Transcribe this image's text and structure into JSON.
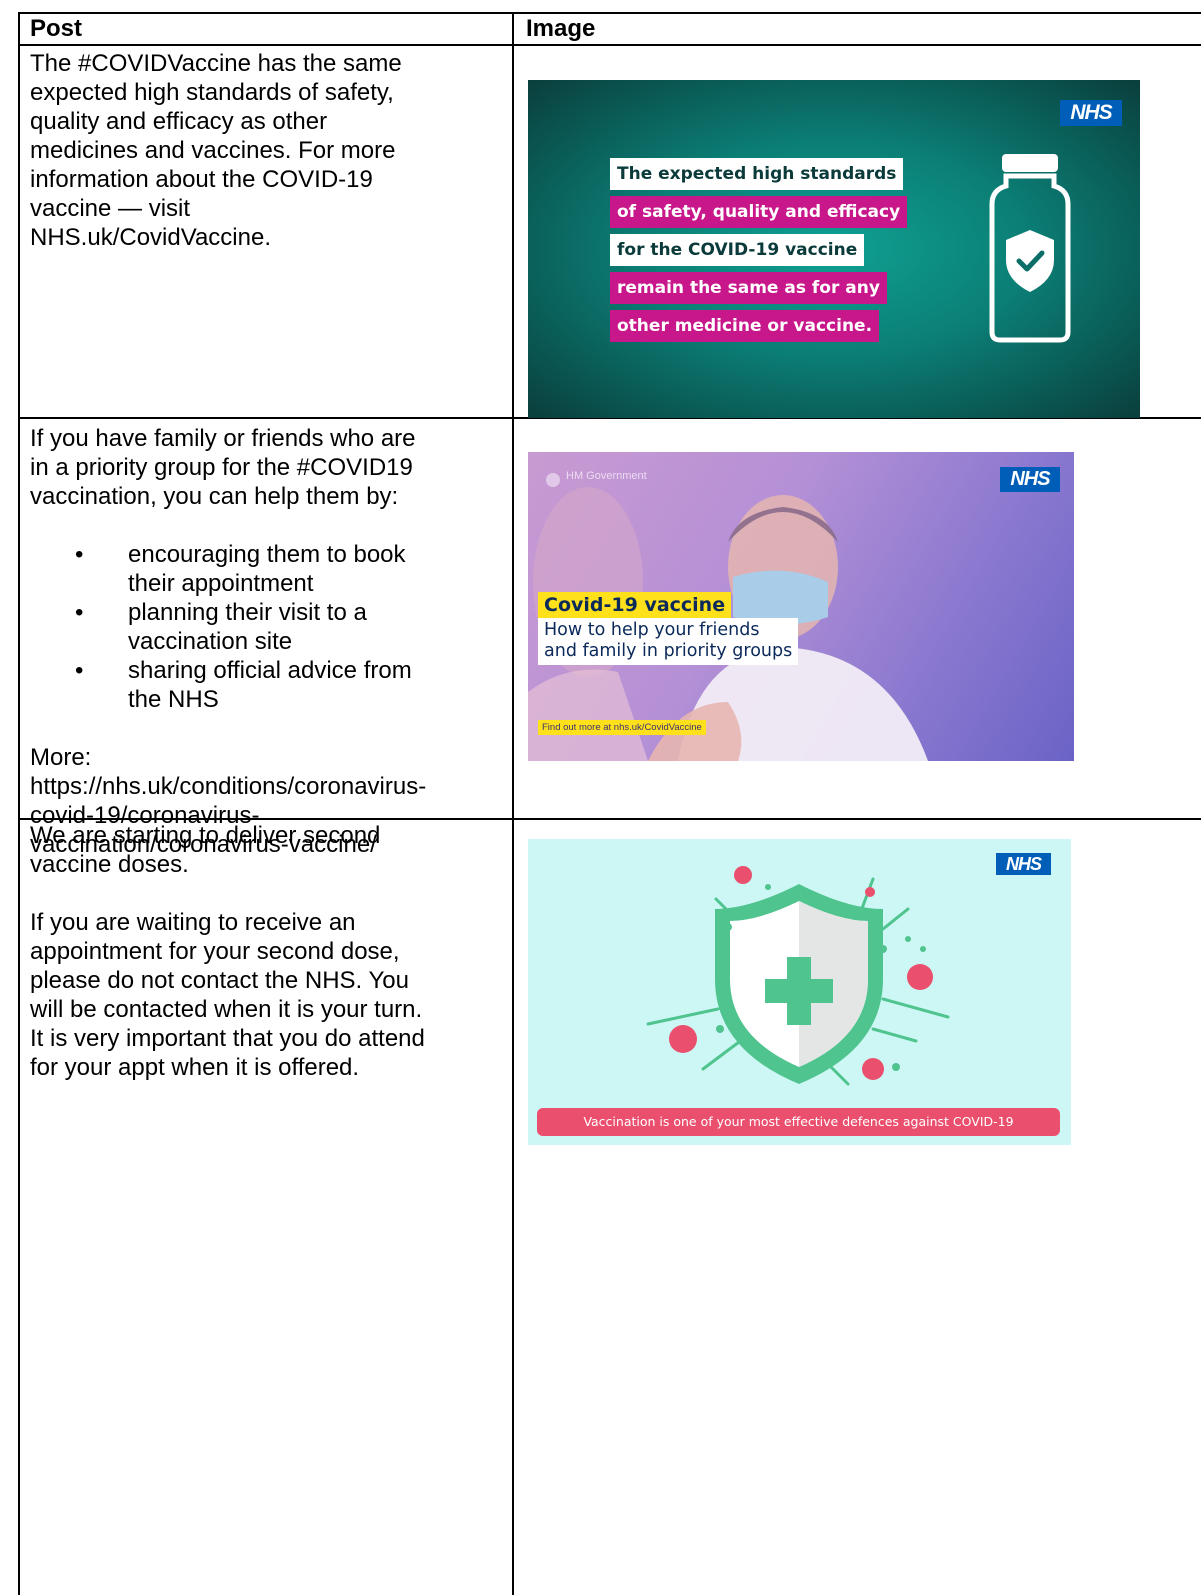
{
  "table": {
    "headers": {
      "post": "Post",
      "image": "Image"
    },
    "rows": [
      {
        "post": {
          "lines": [
            "The #COVIDVaccine has the same",
            "expected high standards of safety,",
            "quality and efficacy as other",
            "medicines and vaccines. For more",
            "information about the COVID-19",
            "vaccine — visit",
            "NHS.uk/CovidVaccine."
          ]
        },
        "image": {
          "logo": "NHS",
          "lines": [
            "The expected high standards",
            "of safety, quality and efficacy",
            "for the COVID-19 vaccine",
            "remain the same as for any",
            "other medicine or vaccine."
          ],
          "colors": {
            "teal": "#0b7e75",
            "pink": "#c8178a",
            "nhs_blue": "#005eb8"
          }
        }
      },
      {
        "post": {
          "intro_lines": [
            "If you have family or friends who are",
            "in a priority group for the #COVID19",
            "vaccination, you can help them by:"
          ],
          "bullets": [
            [
              "encouraging them to book",
              "their appointment"
            ],
            [
              "planning their visit to a",
              "vaccination site"
            ],
            [
              "sharing official advice from",
              "the NHS"
            ]
          ],
          "more_label": "More:",
          "more_url_lines": [
            "https://nhs.uk/conditions/coronavirus-",
            "covid-19/coronavirus-",
            "vaccination/coronavirus-vaccine/"
          ]
        },
        "image": {
          "logo": "NHS",
          "gov_text": "HM Government",
          "title": "Covid-19 vaccine",
          "subtitle_lines": [
            "How to help your friends",
            "and family in priority groups"
          ],
          "footer": "Find out more at nhs.uk/CovidVaccine",
          "colors": {
            "purple": "#b490d6",
            "yellow": "#ffe11b"
          }
        }
      },
      {
        "post": {
          "para1_lines": [
            "We are starting to deliver second",
            "vaccine doses."
          ],
          "para2_lines": [
            "If you are waiting to receive an",
            "appointment for your second dose,",
            "please do not contact the NHS. You",
            "will be contacted when it is your turn.",
            "It is very important that you do attend",
            "for your appt when it is offered."
          ]
        },
        "image": {
          "logo": "NHS",
          "banner": "Vaccination is one of your most effective defences against COVID-19",
          "icons": [
            "shield-icon",
            "plus-icon",
            "virus-icon"
          ],
          "colors": {
            "mint": "#ccf7f4",
            "green": "#4fc48e",
            "coral": "#ea4f6e"
          }
        }
      }
    ]
  }
}
